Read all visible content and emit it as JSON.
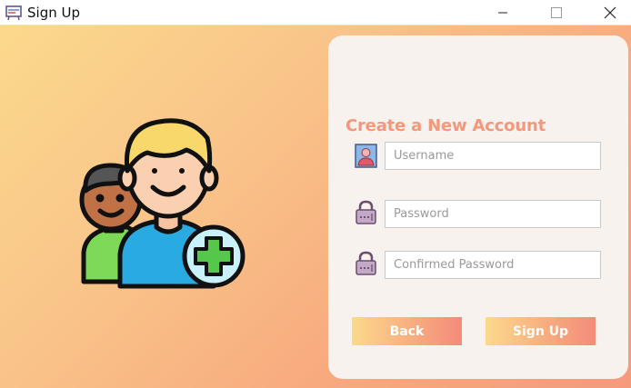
{
  "window": {
    "title": "Sign Up",
    "controls": [
      "minimize",
      "maximize",
      "close"
    ]
  },
  "illustration": {
    "icon": "add-users-icon",
    "colors": {
      "shirt_front": "#29abe2",
      "shirt_back": "#7ed957",
      "plus_circle": "#c8f1fb",
      "plus": "#55c74a"
    }
  },
  "form": {
    "title": "Create a New Account",
    "username": {
      "placeholder": "Username",
      "value": "",
      "icon": "user-card-icon"
    },
    "password": {
      "placeholder": "Password",
      "value": "",
      "icon": "padlock-icon"
    },
    "confirm_password": {
      "placeholder": "Confirmed Password",
      "value": "",
      "icon": "padlock-icon"
    },
    "back_label": "Back",
    "signup_label": "Sign Up"
  },
  "colors": {
    "accent": "#f4977a",
    "background_start": "#fbd98c",
    "background_end": "#f69a7c",
    "card": "#f8f2ef"
  }
}
